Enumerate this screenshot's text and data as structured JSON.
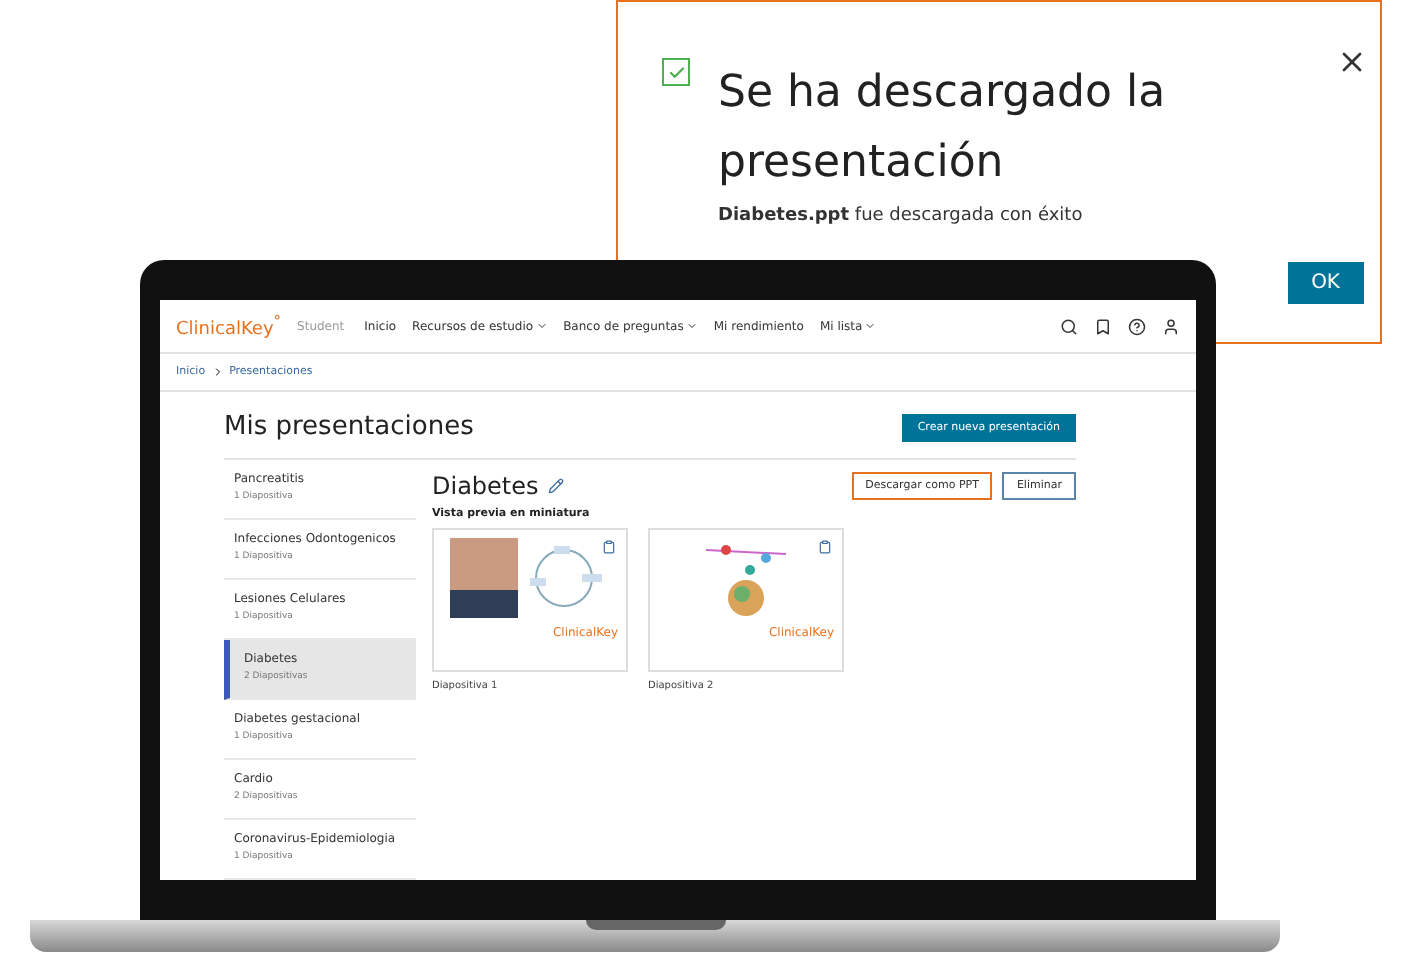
{
  "dialog": {
    "checked": true,
    "title": "Se ha descargado la presentación",
    "message": "**Diabetes.ppt** fue descargada con éxito",
    "ok": "OK"
  },
  "app": {
    "brand": "ClinicalKey",
    "brand_mark": "°",
    "product": "Student",
    "nav": [
      {
        "label": "Inicio",
        "dropdown": false
      },
      {
        "label": "Recursos de estudio",
        "dropdown": true
      },
      {
        "label": "Banco de preguntas",
        "dropdown": true
      },
      {
        "label": "Mi rendimiento",
        "dropdown": false
      },
      {
        "label": "Mi lista",
        "dropdown": true
      }
    ],
    "breadcrumb": [
      "Inicio",
      "Presentaciones"
    ],
    "page_title": "Mis presentaciones",
    "create_button": "Crear nueva presentación",
    "presentations": [
      {
        "name": "Pancreatitis",
        "count": "1 Diapositiva",
        "selected": false
      },
      {
        "name": "Infecciones Odontogenicos",
        "count": "1 Diapositiva",
        "selected": false
      },
      {
        "name": "Lesiones Celulares",
        "count": "1 Diapositiva",
        "selected": false
      },
      {
        "name": "Diabetes",
        "count": "2 Diapositivas",
        "selected": true
      },
      {
        "name": "Diabetes gestacional",
        "count": "1 Diapositiva",
        "selected": false
      },
      {
        "name": "Cardio",
        "count": "2 Diapositivas",
        "selected": false
      },
      {
        "name": "Coronavirus-Epidemiologia",
        "count": "1 Diapositiva",
        "selected": false
      }
    ],
    "detail": {
      "title": "Diabetes",
      "buttons": [
        {
          "label": "Descargar como PPT",
          "kind": "highlighted"
        },
        {
          "label": "Eliminar",
          "kind": "outline"
        }
      ],
      "thumbnails_label": "Vista previa en miniatura",
      "slides": [
        {
          "label": "Diapositiva 1",
          "kind": "photo",
          "logo": "ClinicalKey"
        },
        {
          "label": "Diapositiva 2",
          "kind": "diagram",
          "logo": "ClinicalKey"
        }
      ]
    }
  }
}
